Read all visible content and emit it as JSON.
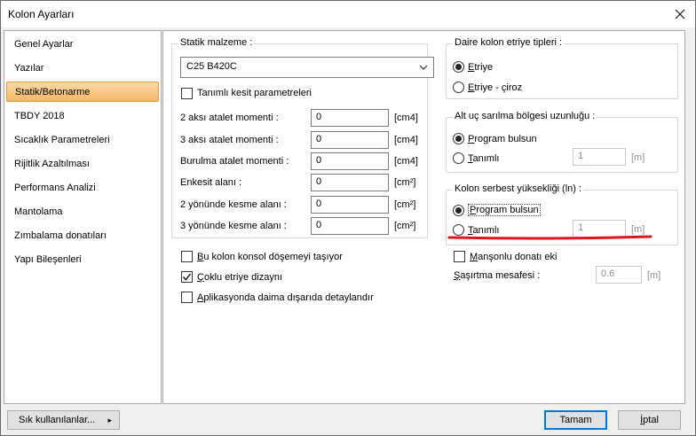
{
  "window": {
    "title": "Kolon Ayarları"
  },
  "sidebar": {
    "items": [
      "Genel Ayarlar",
      "Yazılar",
      "Statik/Betonarme",
      "TBDY 2018",
      "Sıcaklık Parametreleri",
      "Rijitlik Azaltılması",
      "Performans Analizi",
      "Mantolama",
      "Zımbalama donatıları",
      "Yapı Bileşenleri"
    ],
    "active_index": 2
  },
  "static": {
    "group_title": "Statik malzeme :",
    "material_value": "C25 B420C",
    "custom_section_label": "Tanımlı kesit parametreleri",
    "rows": [
      {
        "label": "2 aksı atalet momenti :",
        "value": "0",
        "unit": "[cm4]"
      },
      {
        "label": "3 aksı atalet momenti :",
        "value": "0",
        "unit": "[cm4]"
      },
      {
        "label": "Burulma atalet momenti :",
        "value": "0",
        "unit": "[cm4]"
      },
      {
        "label": "Enkesit alanı :",
        "value": "0",
        "unit": "[cm²]"
      },
      {
        "label": "2 yönünde kesme alanı :",
        "value": "0",
        "unit": "[cm²]"
      },
      {
        "label": "3 yönünde kesme alanı :",
        "value": "0",
        "unit": "[cm²]"
      }
    ]
  },
  "options": {
    "cantilever_label_u": "B",
    "cantilever_label": "u kolon konsol döşemeyi taşıyor",
    "multi_stirrup_label_u": "Ç",
    "multi_stirrup_label": "oklu etriye dizaynı",
    "aplikasyon_label_u": "A",
    "aplikasyon_label": "plikasyonda daima dışarıda detaylandır",
    "mansonlu_label_u": "M",
    "mansonlu_label": "anşonlu donatı eki",
    "sasirtma_label_u": "Ş",
    "sasirtma_label": "aşırtma mesafesi :",
    "sasirtma_value": "0.6",
    "sasirtma_unit": "[m]"
  },
  "circular": {
    "title": "Daire kolon etriye tipleri :",
    "opt1_u": "E",
    "opt1": "triye",
    "opt2_u": "E",
    "opt2": "triye - çiroz"
  },
  "bottom": {
    "title": "Alt uç sarılma bölgesi uzunluğu :",
    "opt1_u": "P",
    "opt1": "rogram bulsun",
    "opt2_u": "T",
    "opt2": "anımlı",
    "value": "1",
    "unit": "[m]"
  },
  "free": {
    "title": "Kolon serbest yüksekliği (ln) :",
    "opt1_u": "P",
    "opt1": "rogram bulsun",
    "opt2_u": "T",
    "opt2": "anımlı",
    "value": "1",
    "unit": "[m]"
  },
  "footer": {
    "frequent": "Sık kullanılanlar...",
    "frequent_arrow": "▸",
    "ok": "Tamam",
    "cancel_u": "İ",
    "cancel": "ptal"
  },
  "colors": {
    "annotation_red": "#e0161d",
    "active_bg": "#f6b867",
    "accent_blue": "#0078d7"
  }
}
